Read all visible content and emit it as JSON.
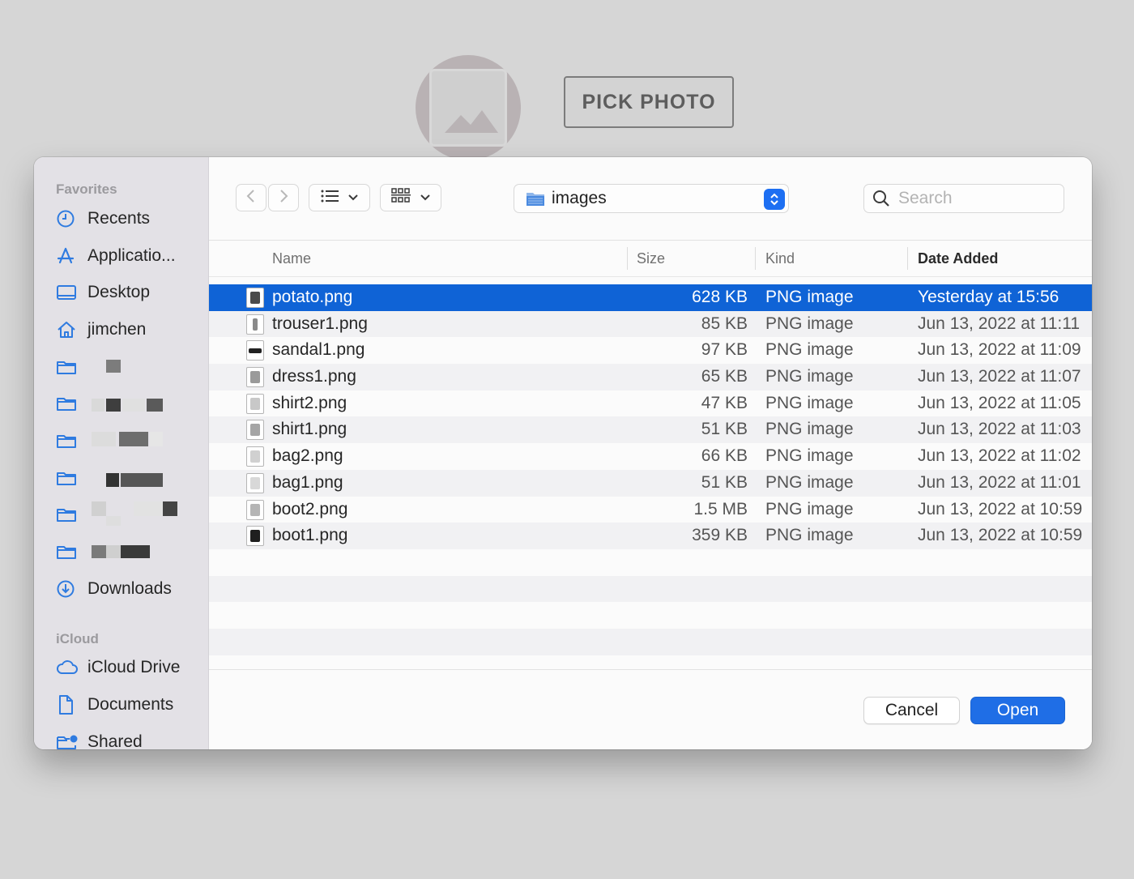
{
  "background_app": {
    "pick_button_label": "PICK PHOTO",
    "avatar_icon": "image-placeholder-icon"
  },
  "dialog": {
    "sidebar": {
      "favorites_header": "Favorites",
      "favorites": [
        {
          "label": "Recents",
          "icon": "clock-icon"
        },
        {
          "label": "Applicatio...",
          "icon": "applications-icon"
        },
        {
          "label": "Desktop",
          "icon": "desktop-icon"
        },
        {
          "label": "jimchen",
          "icon": "home-icon"
        },
        {
          "label": "",
          "icon": "folder-icon"
        },
        {
          "label": "",
          "icon": "folder-icon"
        },
        {
          "label": "",
          "icon": "folder-icon"
        },
        {
          "label": "",
          "icon": "folder-icon"
        },
        {
          "label": "",
          "icon": "folder-icon"
        },
        {
          "label": "",
          "icon": "folder-icon"
        },
        {
          "label": "Downloads",
          "icon": "download-icon"
        }
      ],
      "icloud_header": "iCloud",
      "icloud": [
        {
          "label": "iCloud Drive",
          "icon": "cloud-icon"
        },
        {
          "label": "Documents",
          "icon": "document-icon"
        },
        {
          "label": "Shared",
          "icon": "shared-folder-icon"
        }
      ]
    },
    "toolbar": {
      "back_icon": "chevron-left-icon",
      "forward_icon": "chevron-right-icon",
      "list_view_icon": "list-view-icon",
      "grid_view_icon": "grid-view-icon",
      "location": "images",
      "search_placeholder": "Search"
    },
    "columns": {
      "name": "Name",
      "size": "Size",
      "kind": "Kind",
      "date_added": "Date Added"
    },
    "files": [
      {
        "name": "potato.png",
        "size": "628 KB",
        "kind": "PNG image",
        "date": "Yesterday at 15:56",
        "selected": true
      },
      {
        "name": "trouser1.png",
        "size": "85 KB",
        "kind": "PNG image",
        "date": "Jun 13, 2022 at 11:11"
      },
      {
        "name": "sandal1.png",
        "size": "97 KB",
        "kind": "PNG image",
        "date": "Jun 13, 2022 at 11:09"
      },
      {
        "name": "dress1.png",
        "size": "65 KB",
        "kind": "PNG image",
        "date": "Jun 13, 2022 at 11:07"
      },
      {
        "name": "shirt2.png",
        "size": "47 KB",
        "kind": "PNG image",
        "date": "Jun 13, 2022 at 11:05"
      },
      {
        "name": "shirt1.png",
        "size": "51 KB",
        "kind": "PNG image",
        "date": "Jun 13, 2022 at 11:03"
      },
      {
        "name": "bag2.png",
        "size": "66 KB",
        "kind": "PNG image",
        "date": "Jun 13, 2022 at 11:02"
      },
      {
        "name": "bag1.png",
        "size": "51 KB",
        "kind": "PNG image",
        "date": "Jun 13, 2022 at 11:01"
      },
      {
        "name": "boot2.png",
        "size": "1.5 MB",
        "kind": "PNG image",
        "date": "Jun 13, 2022 at 10:59"
      },
      {
        "name": "boot1.png",
        "size": "359 KB",
        "kind": "PNG image",
        "date": "Jun 13, 2022 at 10:59"
      }
    ],
    "buttons": {
      "cancel": "Cancel",
      "open": "Open"
    },
    "colors": {
      "accent": "#1f6ee6",
      "selection": "#0f63d6"
    }
  }
}
